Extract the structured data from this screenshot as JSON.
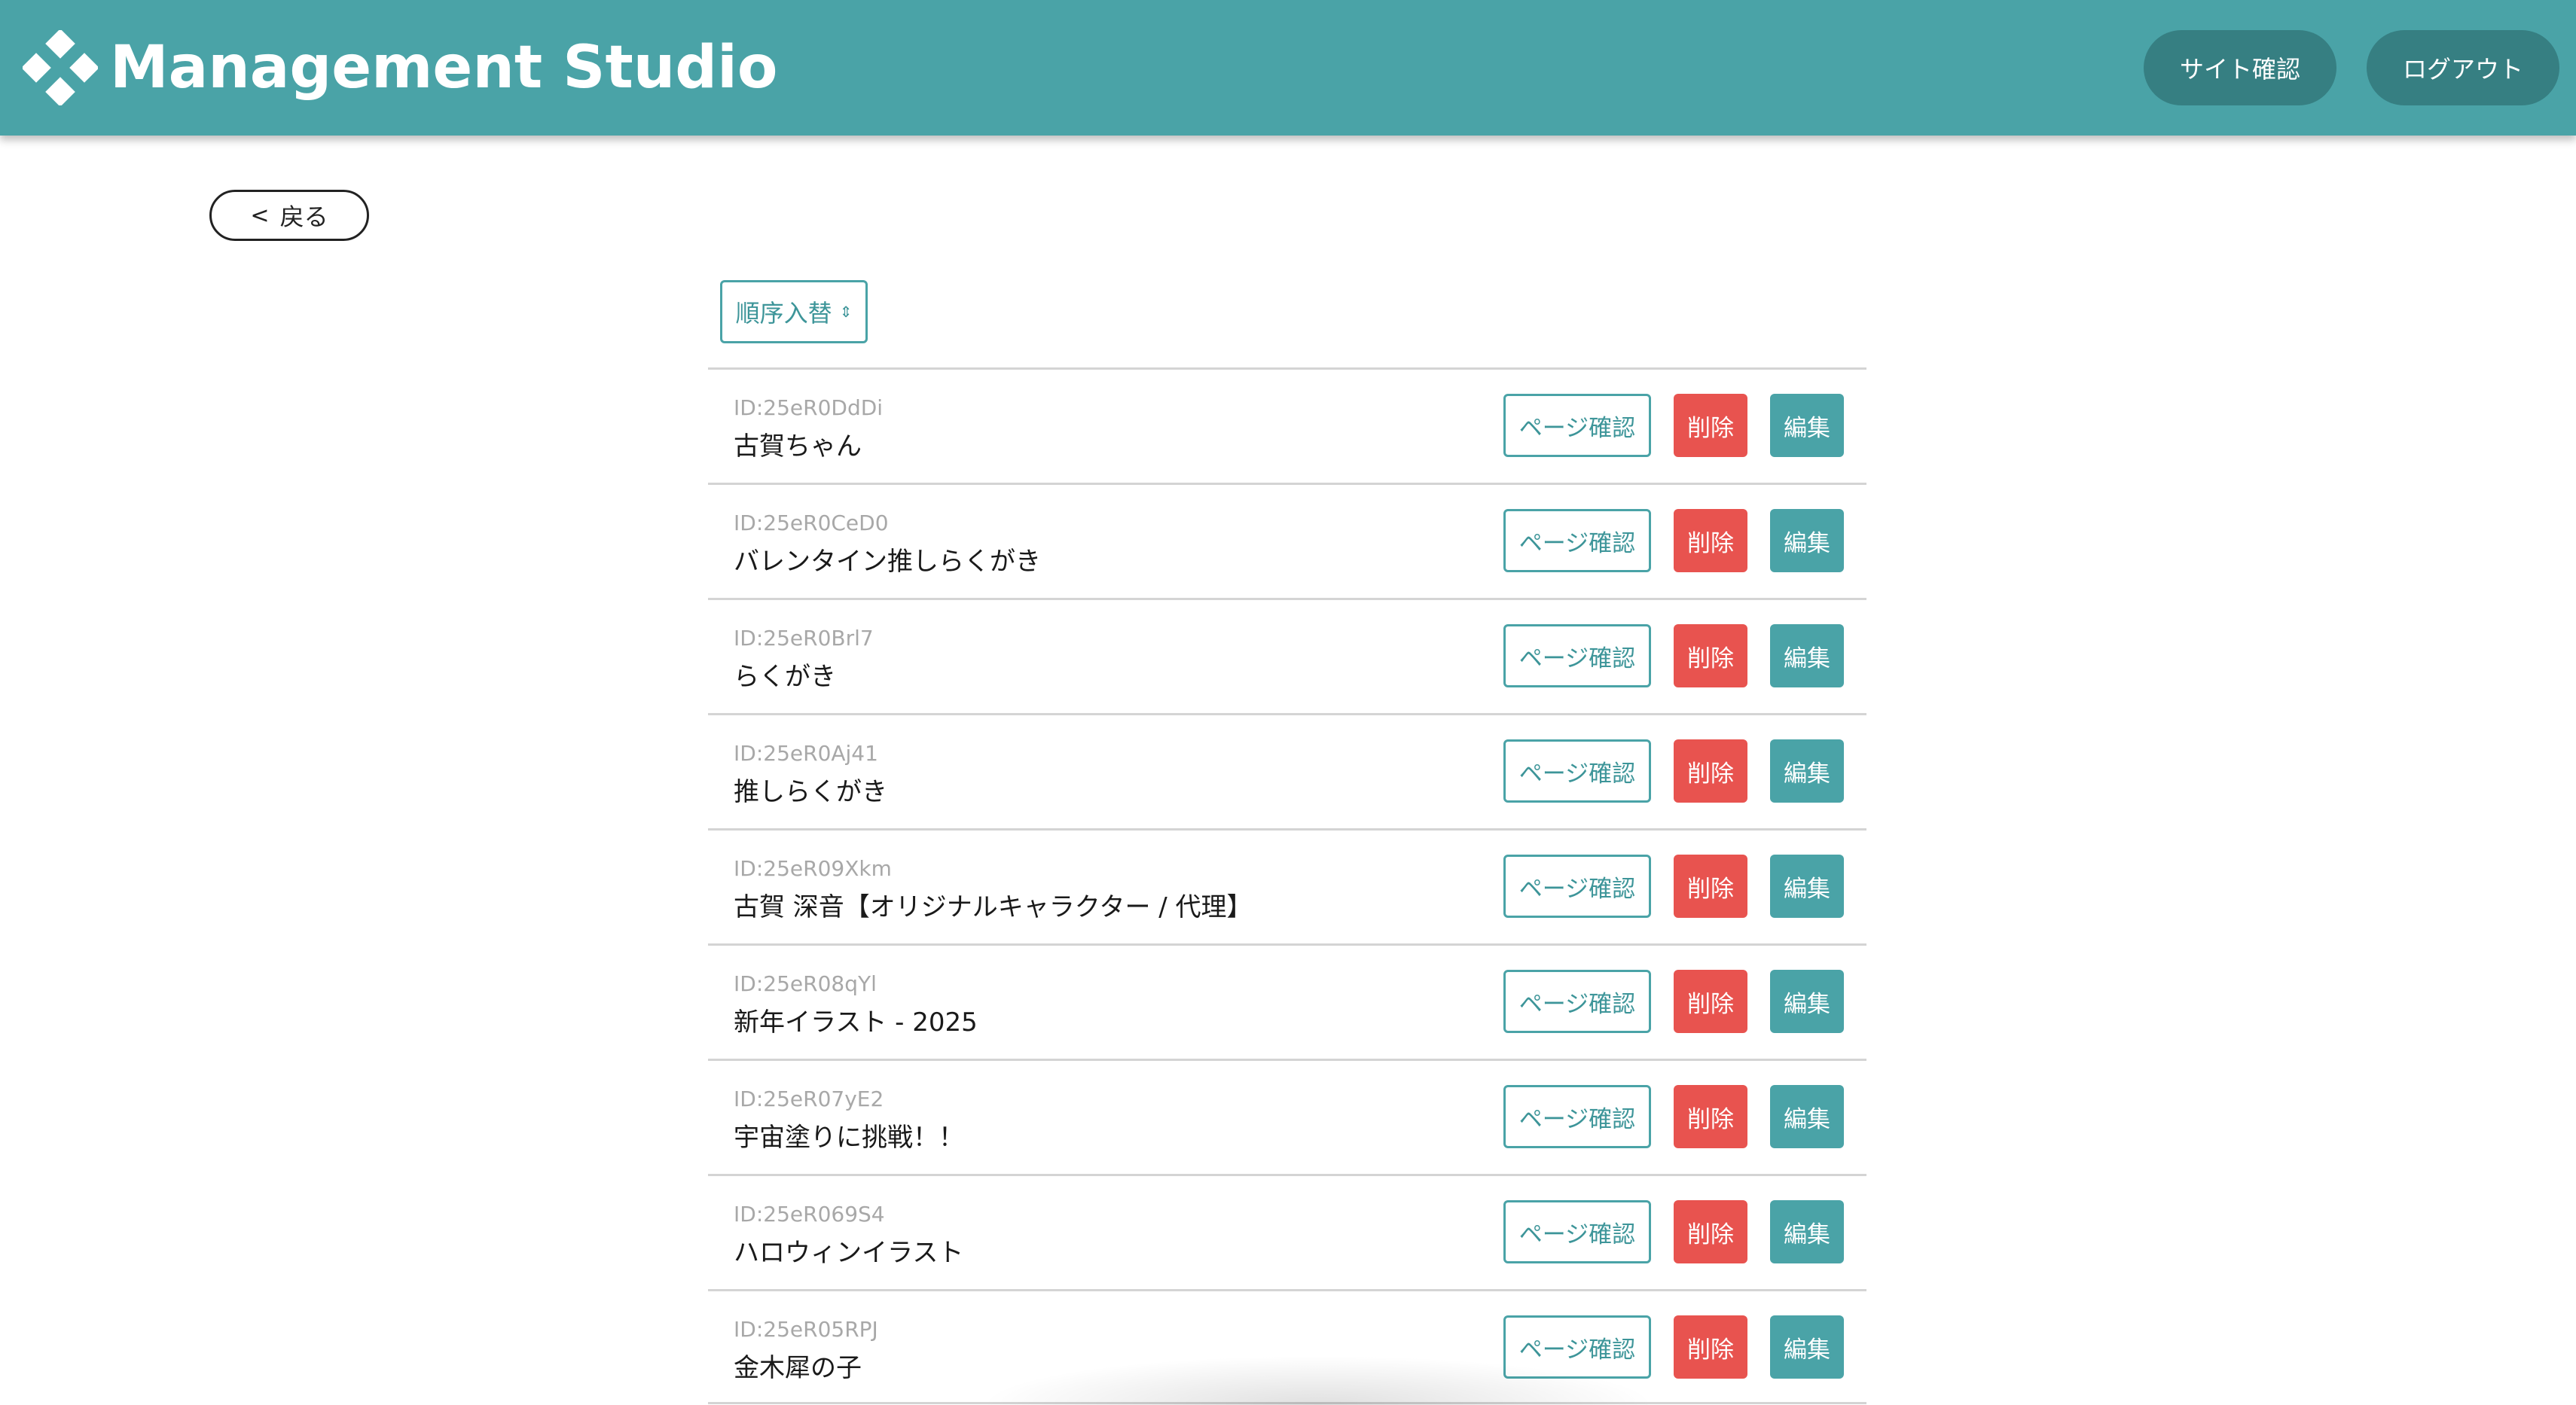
{
  "header": {
    "title": "Management Studio",
    "site_check_label": "サイト確認",
    "logout_label": "ログアウト",
    "logo_icon": "diamond-cluster-logo-icon"
  },
  "back": {
    "label": "戻る",
    "icon": "chevron-left-icon"
  },
  "sort": {
    "label": "順序入替",
    "icon": "up-down-arrows-icon"
  },
  "row_actions": {
    "preview_label": "ページ確認",
    "delete_label": "削除",
    "edit_label": "編集"
  },
  "items": [
    {
      "id": "ID:25eR0DdDi",
      "title": "古賀ちゃん"
    },
    {
      "id": "ID:25eR0CeD0",
      "title": "バレンタイン推しらくがき"
    },
    {
      "id": "ID:25eR0Brl7",
      "title": "らくがき"
    },
    {
      "id": "ID:25eR0Aj41",
      "title": "推しらくがき"
    },
    {
      "id": "ID:25eR09Xkm",
      "title": "古賀 深音【オリジナルキャラクター / 代理】"
    },
    {
      "id": "ID:25eR08qYl",
      "title": "新年イラスト - 2025"
    },
    {
      "id": "ID:25eR07yE2",
      "title": "宇宙塗りに挑戦！！"
    },
    {
      "id": "ID:25eR069S4",
      "title": "ハロウィンイラスト"
    },
    {
      "id": "ID:25eR05RPJ",
      "title": "金木犀の子"
    }
  ],
  "colors": {
    "brand": "#4aa3a7",
    "brand_dark": "#367f82",
    "danger": "#e8534f"
  }
}
